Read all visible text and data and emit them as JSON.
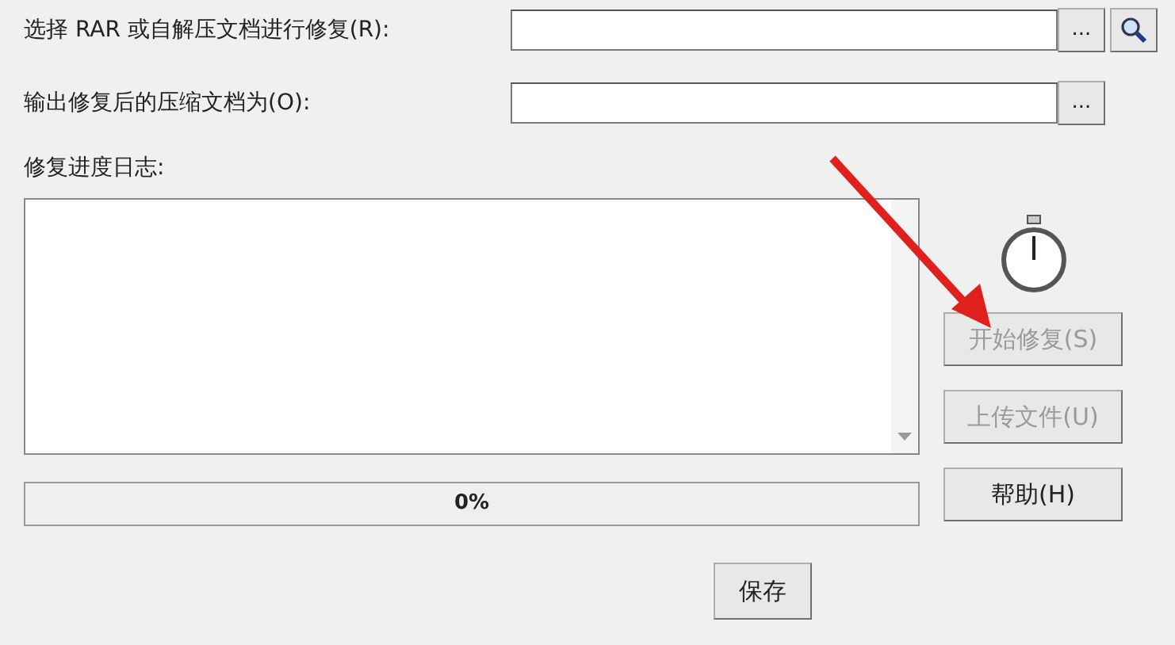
{
  "fields": [
    {
      "label": "选择 RAR 或自解压文档进行修复(R):",
      "browse": "...",
      "search_button": true
    },
    {
      "label": "输出修复后的压缩文档为(O):",
      "browse": "...",
      "search_button": false
    }
  ],
  "log": {
    "label": "修复进度日志:"
  },
  "actions": [
    {
      "label": "开始修复(S)",
      "disabled": true
    },
    {
      "label": "上传文件(U)",
      "disabled": true
    },
    {
      "label": "帮助(H)",
      "disabled": false
    }
  ],
  "progress": {
    "level": 0,
    "reading": "0%"
  },
  "save_button": "保存"
}
